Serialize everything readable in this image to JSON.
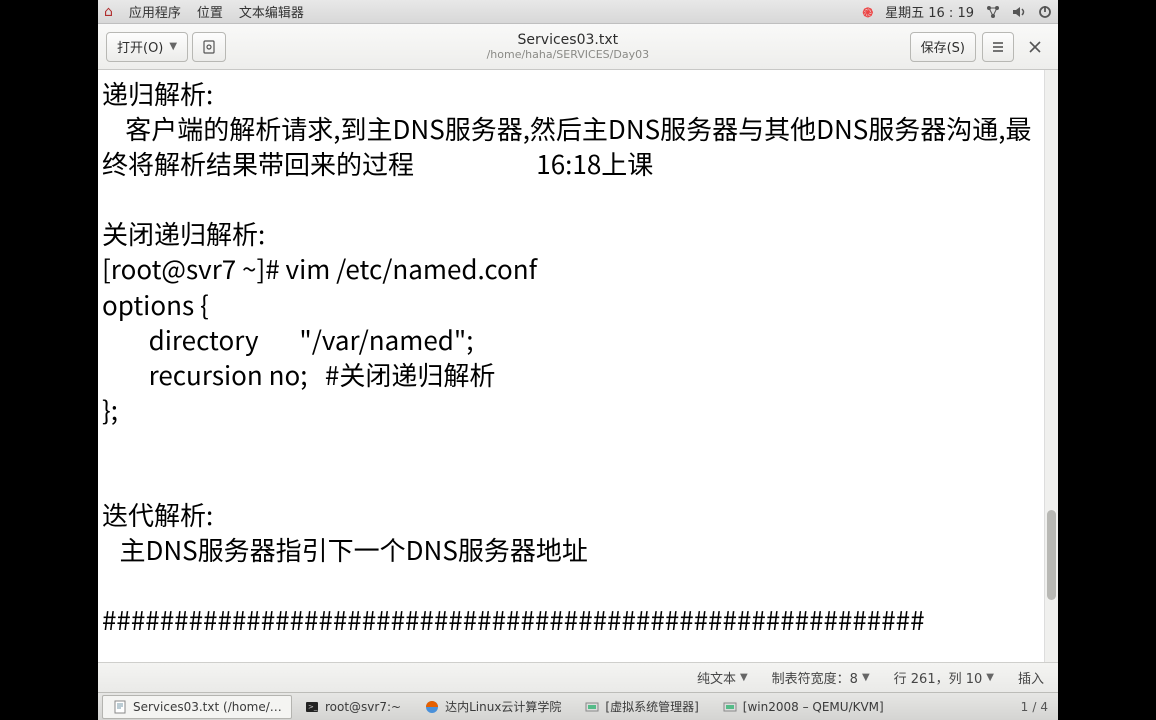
{
  "topbar": {
    "apps": "应用程序",
    "places": "位置",
    "app_name": "文本编辑器",
    "clock": "星期五 16 : 19"
  },
  "header": {
    "open_label": "打开(O)",
    "save_label": "保存(S)",
    "title": "Services03.txt",
    "subtitle": "/home/haha/SERVICES/Day03"
  },
  "editor": {
    "content": "递归解析:\n    客户端的解析请求,到主DNS服务器,然后主DNS服务器与其他DNS服务器沟通,最终将解析结果带回来的过程                     16:18上课\n\n关闭递归解析:\n[root@svr7 ~]# vim /etc/named.conf\noptions {\n        directory       \"/var/named\";\n        recursion no;   #关闭递归解析\n};\n\n\n迭代解析:\n   主DNS服务器指引下一个DNS服务器地址\n\n#########################################################"
  },
  "status": {
    "syntax": "纯文本",
    "tabwidth": "制表符宽度：8",
    "position": "行 261，列 10",
    "mode": "插入"
  },
  "taskbar": {
    "t1": "Services03.txt (/home/…",
    "t2": "root@svr7:~",
    "t3": "达内Linux云计算学院",
    "t4": "[虚拟系统管理器]",
    "t5": "[win2008 – QEMU/KVM]"
  },
  "workspace": {
    "current": "1",
    "sep": "/",
    "total": "4"
  }
}
